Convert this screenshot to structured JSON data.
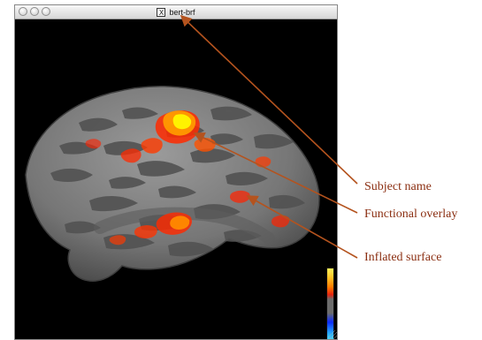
{
  "window": {
    "title": "bert-brf",
    "title_icon": "X",
    "title_icon_name": "x11-icon"
  },
  "annotations": {
    "subject_name": "Subject name",
    "functional_overlay": "Functional overlay",
    "inflated_surface": "Inflated surface"
  },
  "colors": {
    "background": "#000000",
    "surface_dark": "#5b5b5b",
    "surface_light": "#8f8f8f",
    "activation_red": "#ff2a00",
    "activation_orange": "#ff8a00",
    "activation_yellow": "#fff200",
    "annotation": "#b4531e"
  }
}
